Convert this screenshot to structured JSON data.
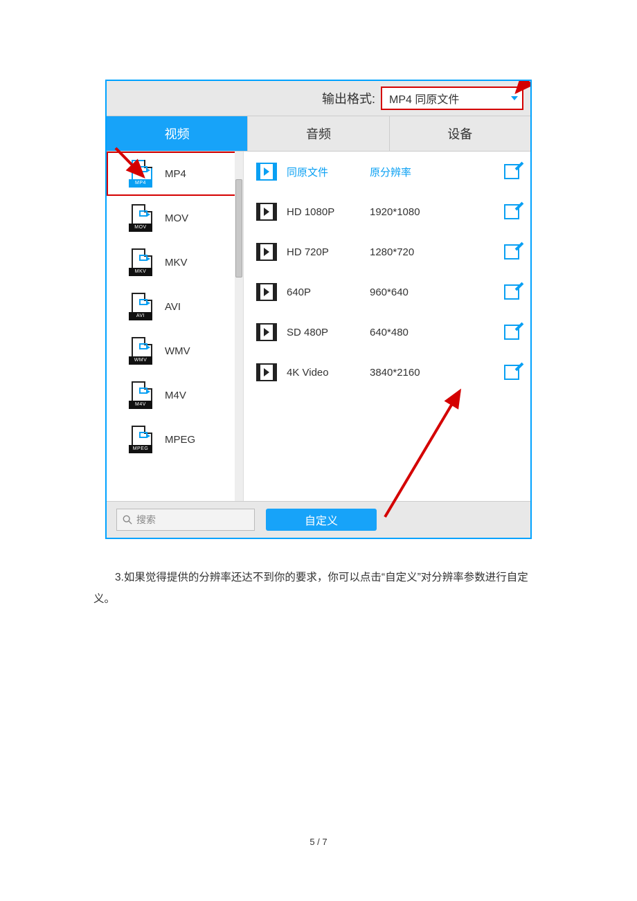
{
  "topbar": {
    "label": "输出格式:",
    "selected": "MP4 同原文件"
  },
  "tabs": {
    "video": "视频",
    "audio": "音频",
    "device": "设备"
  },
  "formats": [
    {
      "label": "MP4",
      "tag": "MP4",
      "selected": true
    },
    {
      "label": "MOV",
      "tag": "MOV",
      "selected": false
    },
    {
      "label": "MKV",
      "tag": "MKV",
      "selected": false
    },
    {
      "label": "AVI",
      "tag": "AVI",
      "selected": false
    },
    {
      "label": "WMV",
      "tag": "WMV",
      "selected": false
    },
    {
      "label": "M4V",
      "tag": "M4V",
      "selected": false
    },
    {
      "label": "MPEG",
      "tag": "MPEG",
      "selected": false
    }
  ],
  "resolutions": [
    {
      "name": "同原文件",
      "dim": "原分辨率",
      "selected": true
    },
    {
      "name": "HD 1080P",
      "dim": "1920*1080",
      "selected": false
    },
    {
      "name": "HD 720P",
      "dim": "1280*720",
      "selected": false
    },
    {
      "name": "640P",
      "dim": "960*640",
      "selected": false
    },
    {
      "name": "SD 480P",
      "dim": "640*480",
      "selected": false
    },
    {
      "name": "4K Video",
      "dim": "3840*2160",
      "selected": false
    }
  ],
  "search_placeholder": "搜索",
  "custom_button": "自定义",
  "body": "3.如果觉得提供的分辨率还达不到你的要求，你可以点击“自定义”对分辨率参数进行自定义。",
  "pager": "5 / 7"
}
